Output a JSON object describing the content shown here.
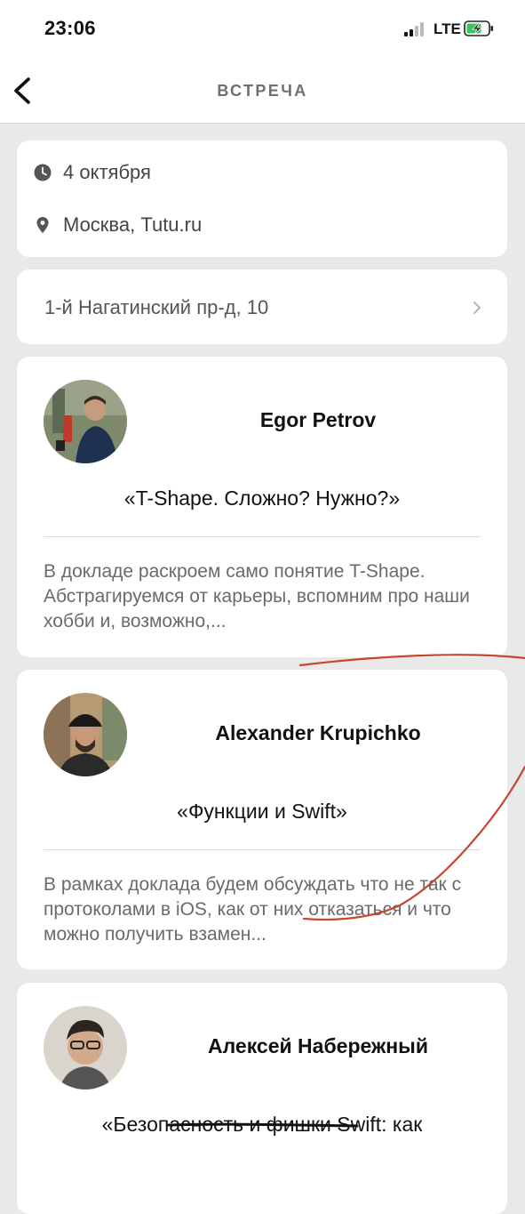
{
  "status": {
    "time": "23:06",
    "network": "LTE"
  },
  "nav": {
    "title": "ВСТРЕЧА"
  },
  "event": {
    "date": "4 октября",
    "location": "Москва, Tutu.ru",
    "address": "1-й Нагатинский пр-д, 10"
  },
  "talks": [
    {
      "speaker": "Egor Petrov",
      "title": "«T-Shape. Сложно? Нужно?»",
      "description": "В докладе раскроем само понятие T-Shape. Абстрагируемся от карьеры, вспомним про наши хобби и, возможно,..."
    },
    {
      "speaker": "Alexander Krupichko",
      "title": "«Функции и Swift»",
      "description": "В рамках доклада будем обсуждать что не так с протоколами в iOS, как от них отказаться и что можно получить взамен..."
    },
    {
      "speaker": "Алексей Набережный",
      "title": "«Безопасность и фишки Swift: как",
      "description": ""
    }
  ],
  "colors": {
    "background": "#e9e9e9",
    "card": "#ffffff",
    "annotation_stroke": "#c8462f"
  }
}
